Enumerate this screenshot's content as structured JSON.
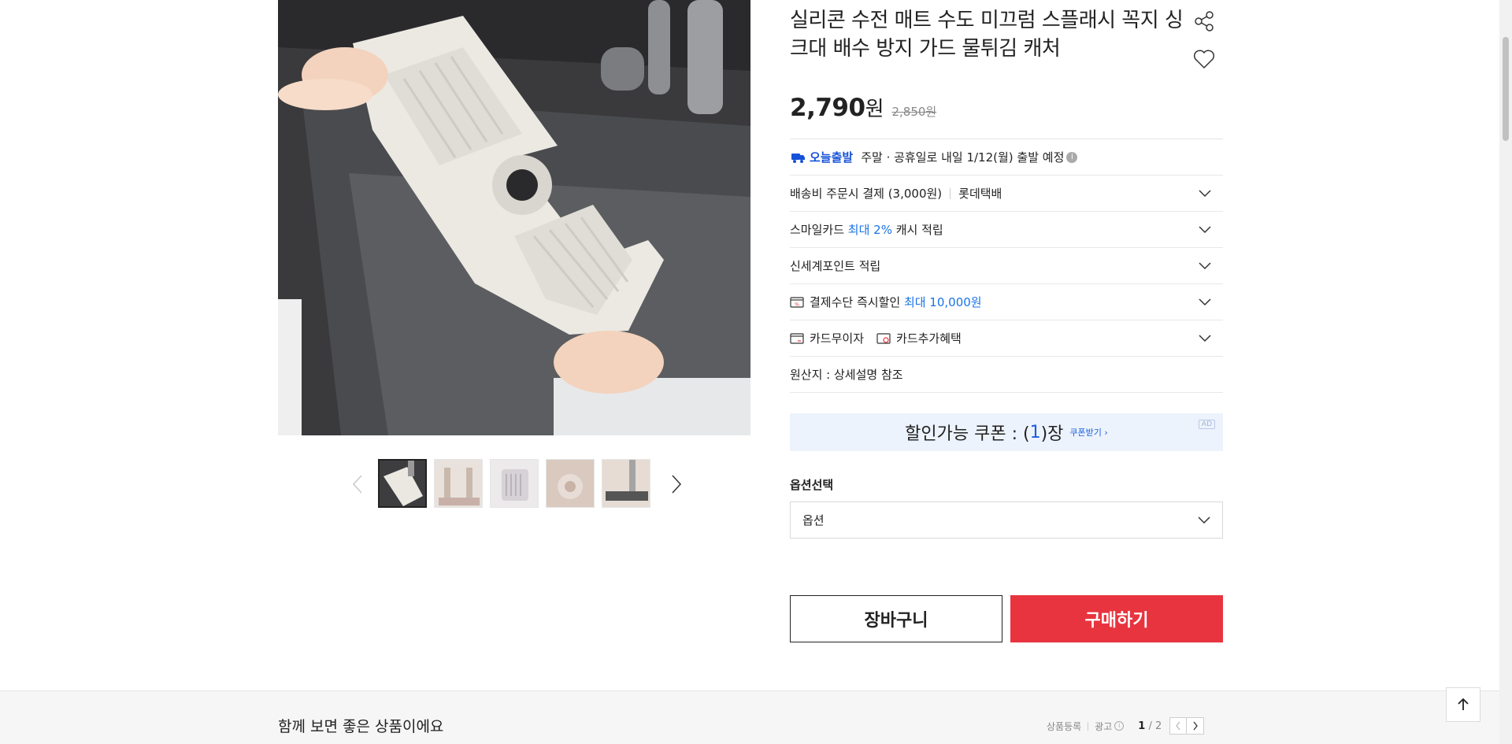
{
  "product": {
    "title": "실리콘 수전 매트 수도 미끄럼 스플래시 꼭지 싱크대 배수 방지 가드 물튀김 캐처",
    "price": "2,790",
    "price_unit": "원",
    "original_price": "2,850원"
  },
  "icons": {
    "share": "share-icon",
    "favorite": "heart-icon",
    "truck": "truck-icon",
    "chevron": "chevron-down-icon",
    "discount": "discount-icon",
    "card": "card-icon",
    "card_benefit": "card-benefit-icon",
    "top": "arrow-up-icon"
  },
  "shipping": {
    "today_label": "오늘출발",
    "today_text": "주말 · 공휴일로 내일 1/12(월) 출발 예정",
    "fee_text": "배송비 주문시 결제 (3,000원)",
    "courier": "롯데택배"
  },
  "benefits": {
    "smile_prefix": "스마일카드 ",
    "smile_highlight": "최대 2%",
    "smile_suffix": " 캐시 적립",
    "shinsegae": "신세계포인트 적립",
    "instant_prefix": "결제수단 즉시할인 ",
    "instant_highlight": "최대 10,000원",
    "card_interest": "카드무이자",
    "card_extra": "카드추가혜택",
    "origin": "원산지 : 상세설명 참조"
  },
  "coupon": {
    "prefix": "할인가능 쿠폰 : (",
    "count": "1",
    "suffix": ")장",
    "link": "쿠폰받기 ›",
    "ad": "AD"
  },
  "option": {
    "label": "옵션선택",
    "selected": "옵션"
  },
  "actions": {
    "cart": "장바구니",
    "buy": "구매하기"
  },
  "bottom": {
    "title": "함께 보면 좋은 상품이에요",
    "register": "상품등록",
    "ad": "광고",
    "info": "i",
    "page_current": "1",
    "page_total": " / 2"
  },
  "colors": {
    "buy_button": "#e8343f",
    "link_blue": "#1a73e8",
    "coupon_bg": "#edf3fc"
  }
}
